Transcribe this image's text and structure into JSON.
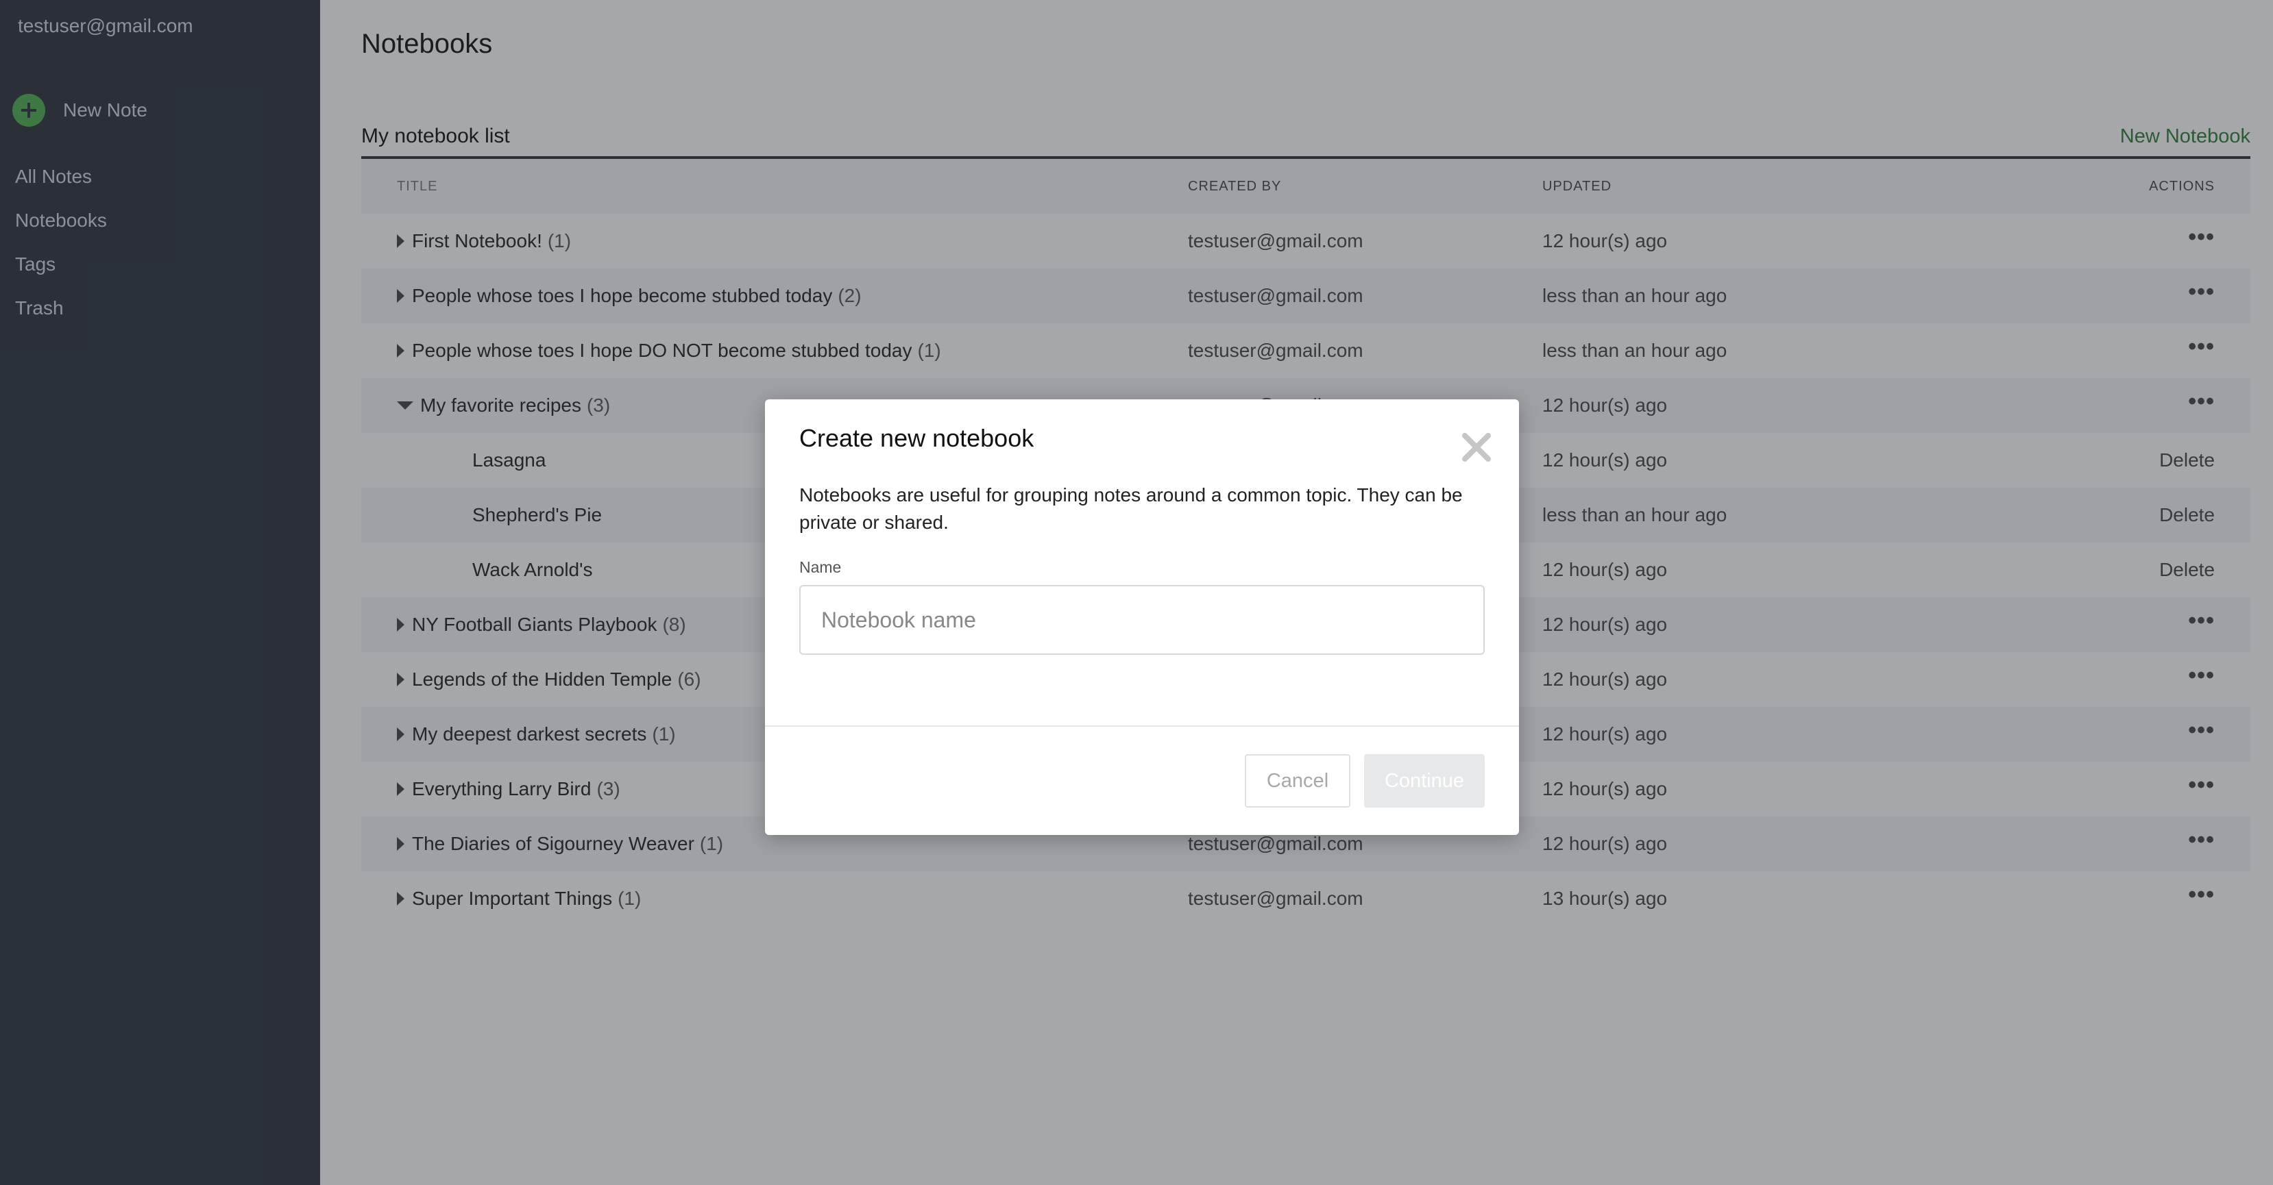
{
  "sidebar": {
    "user_email": "testuser@gmail.com",
    "new_note_label": "New Note",
    "nav": [
      "All Notes",
      "Notebooks",
      "Tags",
      "Trash"
    ]
  },
  "page": {
    "title": "Notebooks",
    "list_title": "My notebook list",
    "new_notebook_label": "New Notebook"
  },
  "table": {
    "headers": {
      "title": "TITLE",
      "created_by": "CREATED BY",
      "updated": "UPDATED",
      "actions": "ACTIONS"
    },
    "rows": [
      {
        "title": "First Notebook!",
        "count": "(1)",
        "created_by": "testuser@gmail.com",
        "updated": "12 hour(s) ago",
        "action": "•••"
      },
      {
        "title": "People whose toes I hope become stubbed today",
        "count": "(2)",
        "created_by": "testuser@gmail.com",
        "updated": "less than an hour ago",
        "action": "•••"
      },
      {
        "title": "People whose toes I hope DO NOT become stubbed today",
        "count": "(1)",
        "created_by": "testuser@gmail.com",
        "updated": "less than an hour ago",
        "action": "•••"
      },
      {
        "title": "My favorite recipes",
        "count": "(3)",
        "created_by": "testuser@gmail.com",
        "updated": "12 hour(s) ago",
        "action": "•••"
      },
      {
        "title": "Lasagna",
        "created_by": "",
        "updated": "12 hour(s) ago",
        "action": "Delete"
      },
      {
        "title": "Shepherd's Pie",
        "created_by": "",
        "updated": "less than an hour ago",
        "action": "Delete"
      },
      {
        "title": "Wack Arnold's",
        "created_by": "",
        "updated": "12 hour(s) ago",
        "action": "Delete"
      },
      {
        "title": "NY Football Giants Playbook",
        "count": "(8)",
        "created_by": "",
        "updated": "12 hour(s) ago",
        "action": "•••"
      },
      {
        "title": "Legends of the Hidden Temple",
        "count": "(6)",
        "created_by": "",
        "updated": "12 hour(s) ago",
        "action": "•••"
      },
      {
        "title": "My deepest darkest secrets",
        "count": "(1)",
        "created_by": "",
        "updated": "12 hour(s) ago",
        "action": "•••"
      },
      {
        "title": "Everything Larry Bird",
        "count": "(3)",
        "created_by": "",
        "updated": "12 hour(s) ago",
        "action": "•••"
      },
      {
        "title": "The Diaries of Sigourney Weaver",
        "count": "(1)",
        "created_by": "testuser@gmail.com",
        "updated": "12 hour(s) ago",
        "action": "•••"
      },
      {
        "title": "Super Important Things",
        "count": "(1)",
        "created_by": "testuser@gmail.com",
        "updated": "13 hour(s) ago",
        "action": "•••"
      }
    ]
  },
  "modal": {
    "title": "Create new notebook",
    "description": "Notebooks are useful for grouping notes around a common topic. They can be private or shared.",
    "name_label": "Name",
    "name_value": "",
    "name_placeholder": "Notebook name",
    "cancel_label": "Cancel",
    "continue_label": "Continue"
  },
  "colors": {
    "sidebar_bg": "#2e333a",
    "accent_green": "#4caf50",
    "link_green": "#2e7d32",
    "overlay": "rgba(40,46,54,0.42)"
  },
  "icons": {
    "new_note": "plus-circle-icon",
    "expand": "caret-right-icon",
    "collapse": "caret-down-icon",
    "more": "ellipsis-icon",
    "close": "close-icon"
  }
}
